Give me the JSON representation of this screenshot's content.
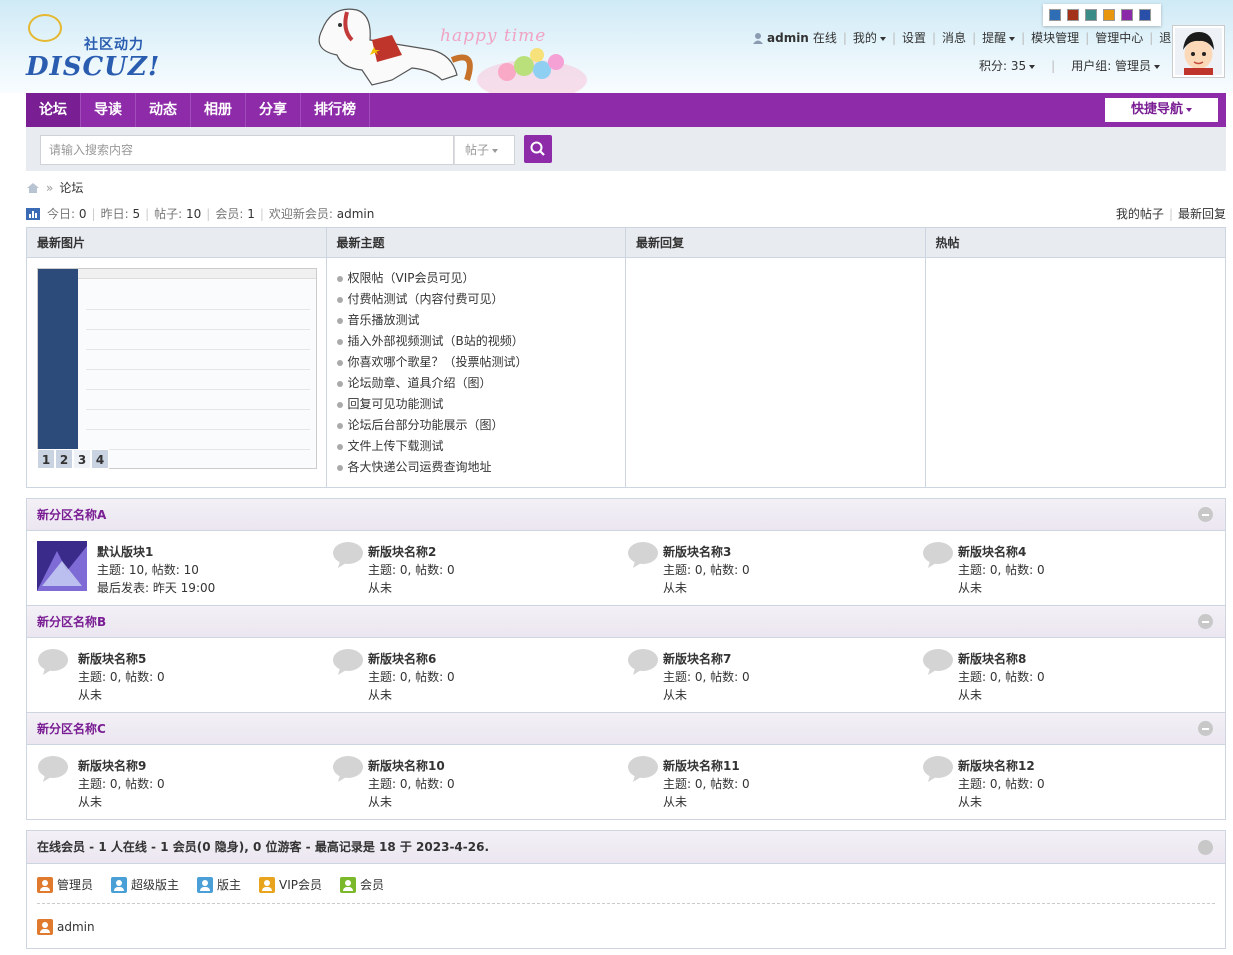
{
  "header": {
    "logo_slogan": "社区动力",
    "logo_word": "DISCUZ!",
    "banner_text": "happy time",
    "color_swatches": [
      "#2f6db5",
      "#a33218",
      "#3b8b87",
      "#e8960e",
      "#8a2aa8",
      "#2a4fa8"
    ]
  },
  "user": {
    "name": "admin",
    "status": "在线",
    "links": [
      "我的",
      "设置",
      "消息",
      "提醒",
      "模块管理",
      "管理中心",
      "退出"
    ],
    "credits": "积分: 35",
    "group": "用户组: 管理员"
  },
  "nav": {
    "items": [
      "论坛",
      "导读",
      "动态",
      "相册",
      "分享",
      "排行榜"
    ],
    "quick_nav": "快捷导航"
  },
  "search": {
    "placeholder": "请输入搜索内容",
    "type": "帖子"
  },
  "breadcrumb": {
    "current": "论坛"
  },
  "stats": {
    "today_label": "今日:",
    "today": "0",
    "yesterday_label": "昨日:",
    "yesterday": "5",
    "posts_label": "帖子:",
    "posts": "10",
    "members_label": "会员:",
    "members": "1",
    "welcome_label": "欢迎新会员:",
    "welcome_user": "admin",
    "my_posts": "我的帖子",
    "latest_replies": "最新回复"
  },
  "portal": {
    "cols": [
      "最新图片",
      "最新主题",
      "最新回复",
      "热帖"
    ],
    "pages": [
      "1",
      "2",
      "3",
      "4"
    ],
    "topics": [
      "权限帖（VIP会员可见）",
      "付费帖测试（内容付费可见）",
      "音乐播放测试",
      "插入外部视频测试（B站的视频）",
      "你喜欢哪个歌星？（投票帖测试）",
      "论坛勋章、道具介绍（图）",
      "回复可见功能测试",
      "论坛后台部分功能展示（图）",
      "文件上传下载测试",
      "各大快递公司运费查询地址"
    ]
  },
  "sections": [
    {
      "title": "新分区名称A",
      "forums": [
        {
          "name": "默认版块1",
          "stats": "主题: 10, 帖数: 10",
          "last": "最后发表: 昨天 19:00"
        },
        {
          "name": "新版块名称2",
          "stats": "主题: 0, 帖数: 0",
          "last": "从未"
        },
        {
          "name": "新版块名称3",
          "stats": "主题: 0, 帖数: 0",
          "last": "从未"
        },
        {
          "name": "新版块名称4",
          "stats": "主题: 0, 帖数: 0",
          "last": "从未"
        }
      ]
    },
    {
      "title": "新分区名称B",
      "forums": [
        {
          "name": "新版块名称5",
          "stats": "主题: 0, 帖数: 0",
          "last": "从未"
        },
        {
          "name": "新版块名称6",
          "stats": "主题: 0, 帖数: 0",
          "last": "从未"
        },
        {
          "name": "新版块名称7",
          "stats": "主题: 0, 帖数: 0",
          "last": "从未"
        },
        {
          "name": "新版块名称8",
          "stats": "主题: 0, 帖数: 0",
          "last": "从未"
        }
      ]
    },
    {
      "title": "新分区名称C",
      "forums": [
        {
          "name": "新版块名称9",
          "stats": "主题: 0, 帖数: 0",
          "last": "从未"
        },
        {
          "name": "新版块名称10",
          "stats": "主题: 0, 帖数: 0",
          "last": "从未"
        },
        {
          "name": "新版块名称11",
          "stats": "主题: 0, 帖数: 0",
          "last": "从未"
        },
        {
          "name": "新版块名称12",
          "stats": "主题: 0, 帖数: 0",
          "last": "从未"
        }
      ]
    }
  ],
  "online": {
    "title": "在线会员 - 1 人在线 - 1 会员(0 隐身), 0 位游客 - 最高记录是 18 于 2023-4-26.",
    "legend": [
      {
        "label": "管理员",
        "color": "#e07a2e"
      },
      {
        "label": "超级版主",
        "color": "#4a9fd6"
      },
      {
        "label": "版主",
        "color": "#4a9fd6"
      },
      {
        "label": "VIP会员",
        "color": "#e8a41c"
      },
      {
        "label": "会员",
        "color": "#7bb82a"
      }
    ],
    "users": [
      "admin"
    ]
  }
}
